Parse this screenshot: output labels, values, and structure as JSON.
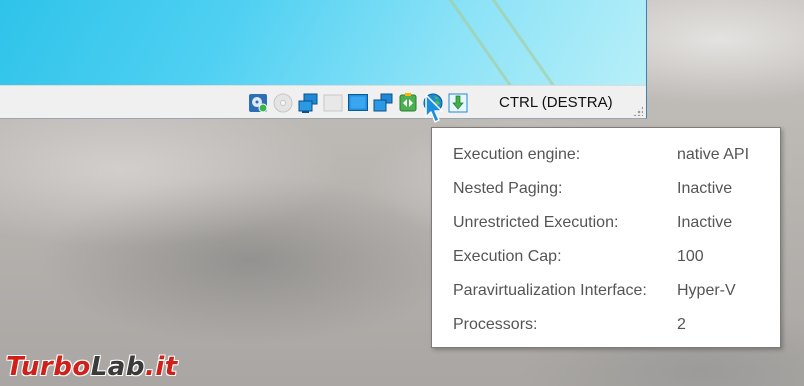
{
  "statusbar": {
    "icons": [
      "hard-disk-icon",
      "optical-drive-icon",
      "network-icon",
      "shared-folders-icon",
      "display-icon",
      "video-capture-icon",
      "cpu-virtualization-icon",
      "guest-additions-icon",
      "keyboard-capture-icon"
    ],
    "host_key": "CTRL (DESTRA)"
  },
  "tooltip": {
    "rows": [
      {
        "label": "Execution engine:",
        "value": "native API"
      },
      {
        "label": "Nested Paging:",
        "value": "Inactive"
      },
      {
        "label": "Unrestricted Execution:",
        "value": "Inactive"
      },
      {
        "label": "Execution Cap:",
        "value": "100"
      },
      {
        "label": "Paravirtualization Interface:",
        "value": "Hyper-V"
      },
      {
        "label": "Processors:",
        "value": "2"
      }
    ]
  },
  "watermark": {
    "part1": "Turbo",
    "part2": "Lab",
    "part3": ".it"
  },
  "colors": {
    "accent": "#2fc3ea",
    "watermark_red": "#d0201a"
  }
}
